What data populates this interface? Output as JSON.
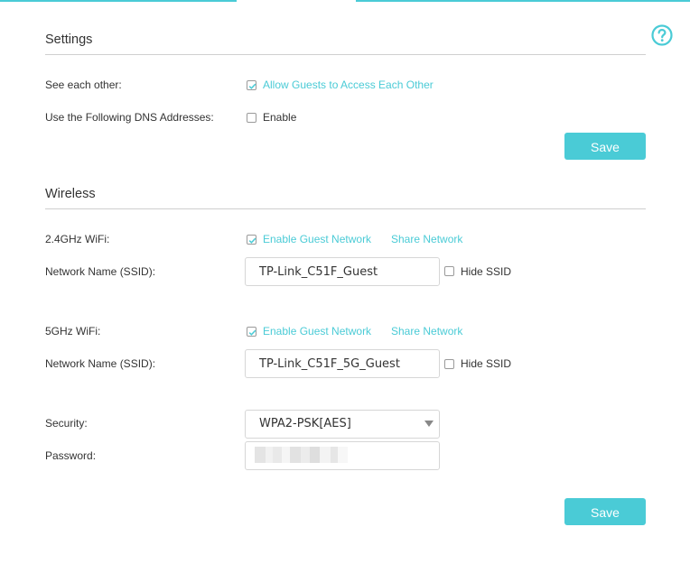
{
  "colors": {
    "accent": "#4acbd6",
    "text": "#333333",
    "divider": "#cfcfcf"
  },
  "icons": {
    "help": "question-circle-icon",
    "check": "check-icon",
    "caret": "caret-down-icon"
  },
  "settings": {
    "title": "Settings",
    "see_each_other": {
      "label": "See each other:",
      "option": "Allow Guests to Access Each Other",
      "checked": true
    },
    "dns": {
      "label": "Use the Following DNS Addresses:",
      "option": "Enable",
      "checked": false
    },
    "save_label": "Save"
  },
  "wireless": {
    "title": "Wireless",
    "wifi24": {
      "label": "2.4GHz WiFi:",
      "enable_label": "Enable Guest Network",
      "enabled": true,
      "share_label": "Share Network",
      "ssid_label": "Network Name (SSID):",
      "ssid_value": "TP-Link_C51F_Guest",
      "hide_ssid_label": "Hide SSID",
      "hide_ssid": false
    },
    "wifi5": {
      "label": "5GHz WiFi:",
      "enable_label": "Enable Guest Network",
      "enabled": true,
      "share_label": "Share Network",
      "ssid_label": "Network Name (SSID):",
      "ssid_value": "TP-Link_C51F_5G_Guest",
      "hide_ssid_label": "Hide SSID",
      "hide_ssid": false
    },
    "security": {
      "label": "Security:",
      "value": "WPA2-PSK[AES]"
    },
    "password": {
      "label": "Password:"
    },
    "save_label": "Save"
  }
}
